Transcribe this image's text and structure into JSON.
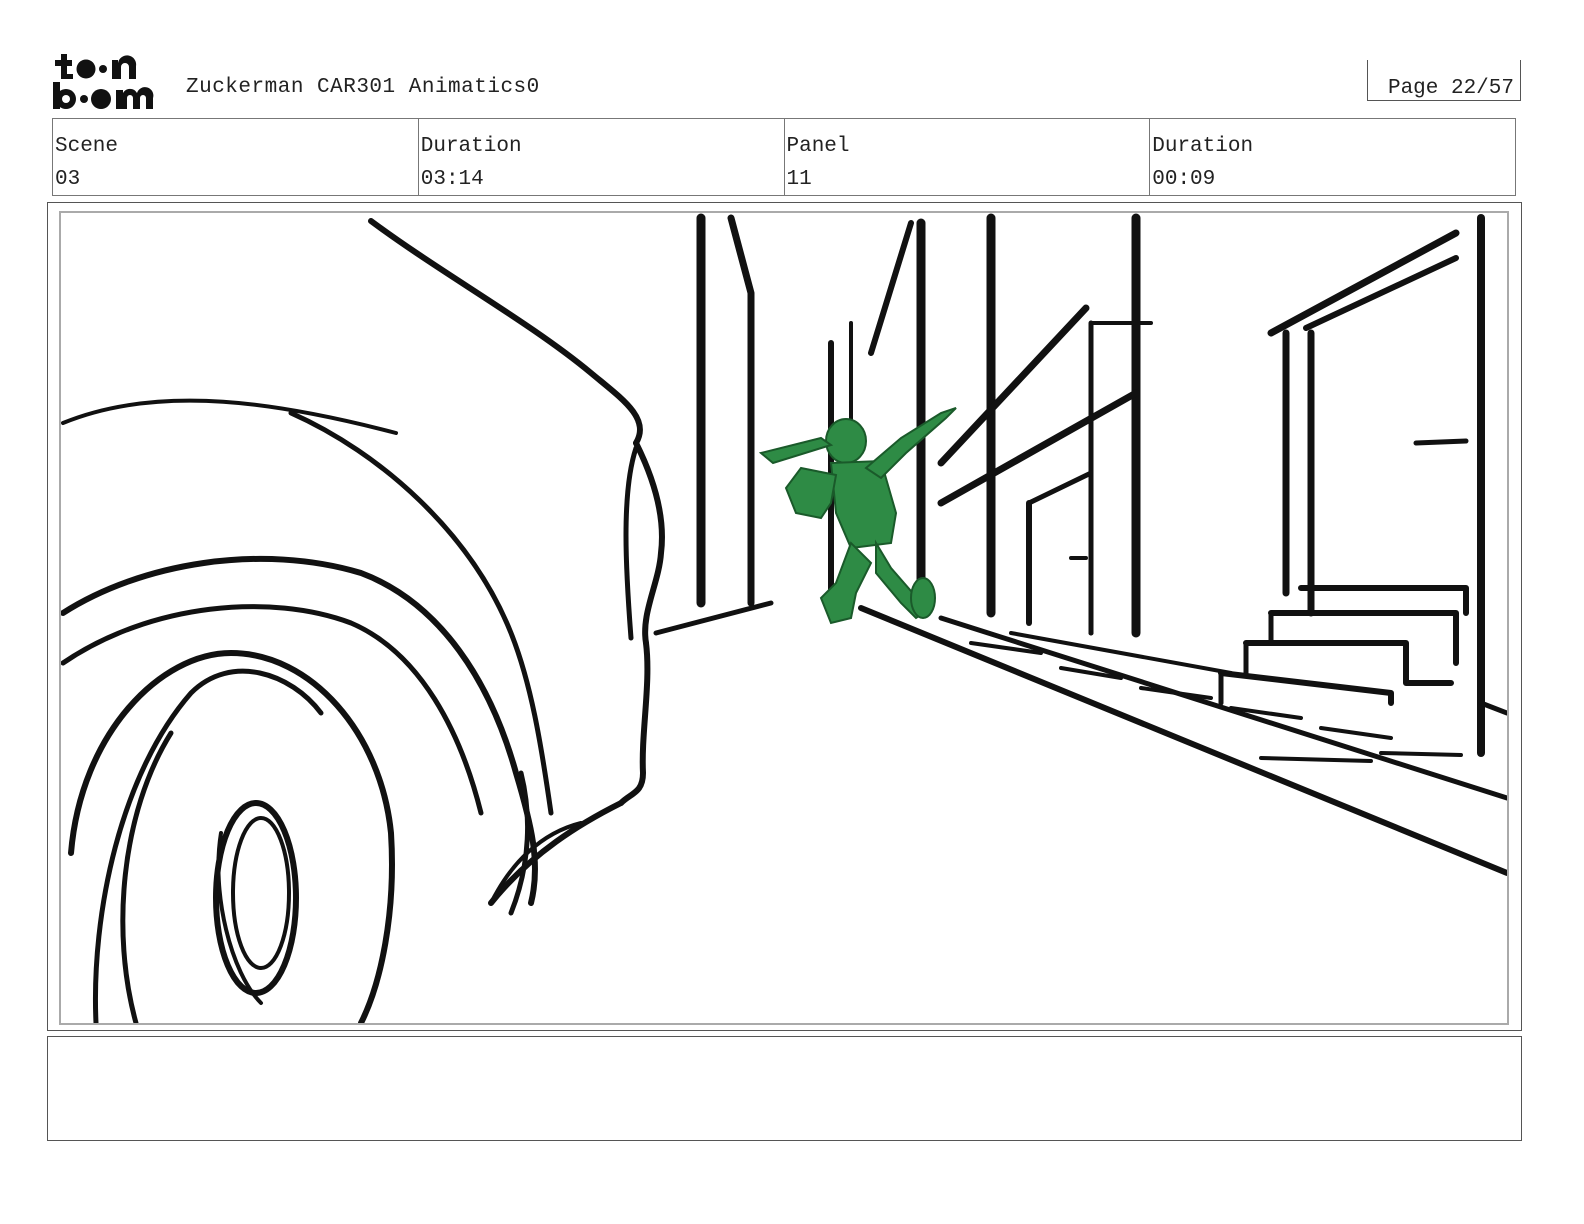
{
  "header": {
    "logo_text": "toonboom",
    "project_title": "Zuckerman CAR301 Animatics0",
    "page_label": "Page 22/57"
  },
  "info": {
    "scene_label": "Scene",
    "scene_value": "03",
    "duration_label": "Duration",
    "duration_value": "03:14",
    "panel_label": "Panel",
    "panel_value": "11",
    "panel_duration_label": "Duration",
    "panel_duration_value": "00:09"
  },
  "panel": {
    "image_description": "storyboard-sketch-car-wheel-foreground-green-figure-running-in-street",
    "figure_color": "#2e8b45",
    "line_color": "#111111"
  },
  "notes": {
    "text": ""
  }
}
